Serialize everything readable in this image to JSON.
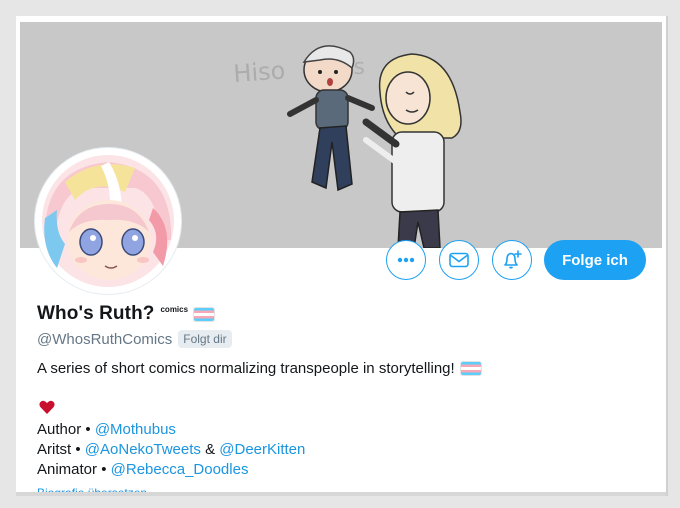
{
  "profile": {
    "name": "Who's Ruth?",
    "name_tag": "comics",
    "handle": "@WhosRuthComics",
    "follows_you": "Folgt dir",
    "bio": "A series of short comics normalizing transpeople in storytelling!",
    "credits": [
      {
        "role": "Author",
        "sep": "•",
        "users": [
          "@Mothubus"
        ]
      },
      {
        "role": "Aritst",
        "sep": "•",
        "users": [
          "@AoNekoTweets",
          "@DeerKitten"
        ],
        "joiner": "&"
      },
      {
        "role": "Animator",
        "sep": "•",
        "users": [
          "@Rebecca_Doodles"
        ]
      }
    ],
    "translate_bio": "Biografie übersetzen"
  },
  "banner": {
    "drawn_text": "Hisoka Loss"
  },
  "actions": {
    "more_icon": "more-icon",
    "dm_icon": "envelope-icon",
    "notify_icon": "bell-plus-icon",
    "follow_label": "Folge ich"
  },
  "colors": {
    "accent": "#1da1f2",
    "link": "#1b95e0",
    "muted": "#657786",
    "banner_bg": "#c8c8c8",
    "heart": "#c8102e"
  }
}
